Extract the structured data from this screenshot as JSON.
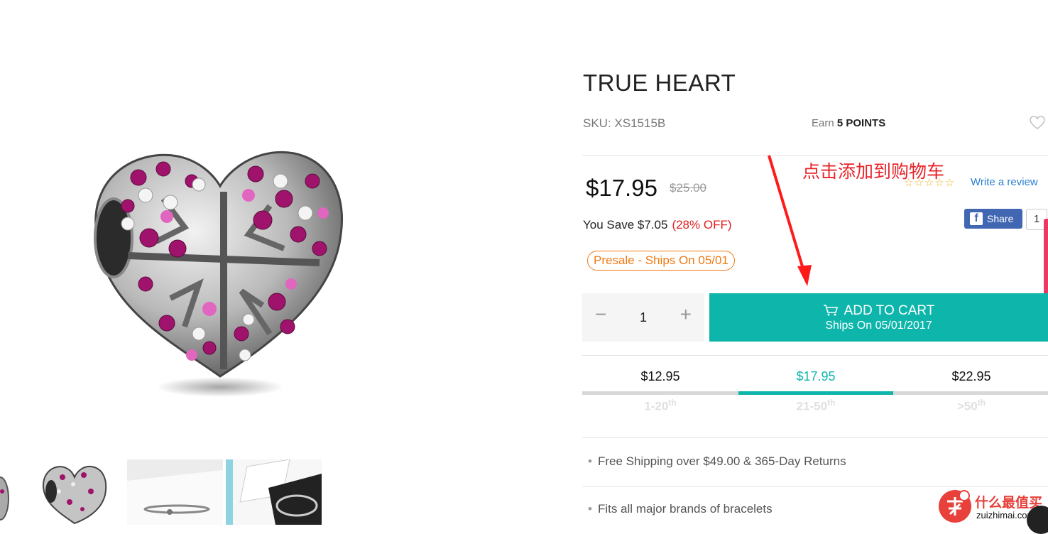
{
  "product": {
    "title": "TRUE HEART",
    "sku": "SKU: XS1515B",
    "earn_prefix": "Earn ",
    "earn_points": "5 POINTS",
    "price": "$17.95",
    "old_price": "$25.00",
    "save": "You Save $7.05",
    "save_pct": "(28% OFF)",
    "presale": "Presale - Ships On 05/01"
  },
  "review": {
    "stars": "☆☆☆☆☆",
    "link": "Write a review"
  },
  "share": {
    "label": "Share",
    "count": "1",
    "fb_letter": "f"
  },
  "annotation": "点击添加到购物车",
  "quantity": {
    "minus": "−",
    "value": "1",
    "plus": "+"
  },
  "cart": {
    "label": "ADD TO CART",
    "ships": "Ships On 05/01/2017"
  },
  "tiers": [
    {
      "price": "$12.95",
      "range": "1-20",
      "sup": "th"
    },
    {
      "price": "$17.95",
      "range": "21-50",
      "sup": "th"
    },
    {
      "price": "$22.95",
      "range": ">50",
      "sup": "th"
    }
  ],
  "features": [
    "Free Shipping over $49.00 & 365-Day Returns",
    "Fits all major brands of bracelets"
  ],
  "watermark": {
    "name": "什么最值买",
    "domain": "zuizhimai.com",
    "badge": "值"
  },
  "colors": {
    "accent": "#0db5ab",
    "sale_red": "#e02020",
    "presale_orange": "#f07a12",
    "facebook": "#4267b2"
  }
}
